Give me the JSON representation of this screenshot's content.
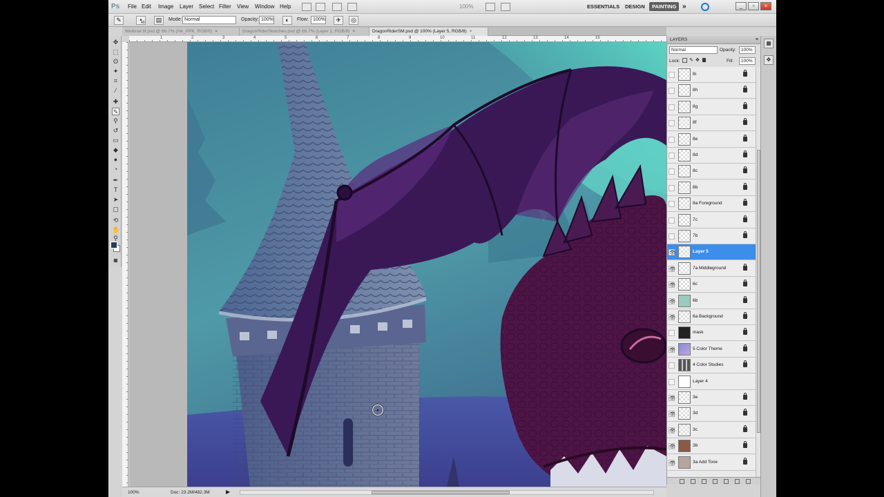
{
  "menubar": {
    "logo": "Ps",
    "menus": [
      "File",
      "Edit",
      "Image",
      "Layer",
      "Select",
      "Filter",
      "View",
      "Window",
      "Help"
    ],
    "zoom": "100%",
    "workspaces": [
      "ESSENTIALS",
      "DESIGN",
      "PAINTING"
    ],
    "active_workspace": "PAINTING",
    "more": "»"
  },
  "options": {
    "brush_size": "40",
    "mode_label": "Mode:",
    "mode_value": "Normal",
    "opacity_label": "Opacity:",
    "opacity_value": "100%",
    "flow_label": "Flow:",
    "flow_value": "100%"
  },
  "tabs": [
    {
      "label": "Webinar.tif.psd @ 66.7% (mk_PPK, RGB/8)",
      "active": false
    },
    {
      "label": "DragonRiderSketches.psd @ 66.7% (Layer 1, RGB/8)",
      "active": false
    },
    {
      "label": "DragonRiderSM.psd @ 100% (Layer 5, RGB/8)",
      "active": true
    }
  ],
  "ruler": {
    "top_numbers": [
      "1",
      "2",
      "3",
      "4",
      "5",
      "6",
      "7",
      "8",
      "9",
      "10",
      "11",
      "12",
      "13",
      "14",
      "15"
    ]
  },
  "layers_panel": {
    "title": "LAYERS",
    "menu_icon": "≡",
    "blend_mode": "Normal",
    "opacity_label": "Opacity:",
    "opacity_value": "100%",
    "lock_label": "Lock:",
    "fill_label": "Fill:",
    "fill_value": "100%",
    "layers": [
      {
        "name": "8i",
        "visible": false,
        "thumb": "trans",
        "selected": false
      },
      {
        "name": "8h",
        "visible": false,
        "thumb": "trans",
        "selected": false
      },
      {
        "name": "8g",
        "visible": false,
        "thumb": "trans",
        "selected": false
      },
      {
        "name": "8f",
        "visible": false,
        "thumb": "trans",
        "selected": false
      },
      {
        "name": "8e",
        "visible": false,
        "thumb": "trans",
        "selected": false
      },
      {
        "name": "8d",
        "visible": false,
        "thumb": "trans",
        "selected": false
      },
      {
        "name": "8c",
        "visible": false,
        "thumb": "trans",
        "selected": false
      },
      {
        "name": "8b",
        "visible": false,
        "thumb": "trans",
        "selected": false
      },
      {
        "name": "8a Foreground",
        "visible": false,
        "thumb": "trans",
        "selected": false
      },
      {
        "name": "7c",
        "visible": false,
        "thumb": "trans",
        "selected": false
      },
      {
        "name": "7b",
        "visible": false,
        "thumb": "trans",
        "selected": false
      },
      {
        "name": "Layer 5",
        "visible": true,
        "thumb": "trans",
        "selected": true
      },
      {
        "name": "7a Middleground",
        "visible": true,
        "thumb": "trans",
        "selected": false
      },
      {
        "name": "6c",
        "visible": true,
        "thumb": "trans",
        "selected": false
      },
      {
        "name": "6b",
        "visible": true,
        "thumb": "t-6b",
        "selected": false
      },
      {
        "name": "6a Background",
        "visible": true,
        "thumb": "trans",
        "selected": false
      },
      {
        "name": "mask",
        "visible": false,
        "thumb": "t-mask",
        "selected": false
      },
      {
        "name": "5 Color Theme",
        "visible": true,
        "thumb": "t-theme",
        "selected": false
      },
      {
        "name": "4 Color Studies",
        "visible": false,
        "thumb": "t-studies",
        "selected": false
      },
      {
        "name": "Layer 4",
        "visible": false,
        "thumb": "t-white",
        "selected": false
      },
      {
        "name": "3e",
        "visible": true,
        "thumb": "trans",
        "selected": false
      },
      {
        "name": "3d",
        "visible": true,
        "thumb": "trans",
        "selected": false
      },
      {
        "name": "3c",
        "visible": true,
        "thumb": "trans",
        "selected": false
      },
      {
        "name": "3b",
        "visible": true,
        "thumb": "t-3b",
        "selected": false
      },
      {
        "name": "3a Add Tone",
        "visible": true,
        "thumb": "t-tone",
        "selected": false
      }
    ]
  },
  "status": {
    "zoom": "100%",
    "doc": "Doc: 23.2M/482.3M",
    "arrow": "▶"
  },
  "colors": {
    "foreground": "#2b3a55",
    "background": "#ffffff",
    "selection": "#3d8eea"
  }
}
